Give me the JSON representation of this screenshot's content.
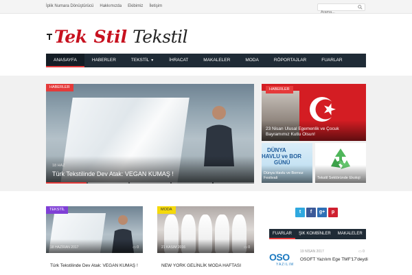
{
  "topbar": {
    "links": [
      "İplik Numara Dönüştürücü",
      "Hakkımızda",
      "Ekibimiz",
      "İletişim"
    ],
    "search_placeholder": "Arama..."
  },
  "logo": {
    "part1": "Tek",
    "part2": "Stil",
    "part3": "Tekstil"
  },
  "nav": {
    "items": [
      "ANASAYFA",
      "HABERLER",
      "TEKSTİL",
      "İHRACAT",
      "MAKALELER",
      "MODA",
      "RÖPORTAJLAR",
      "FUARLAR"
    ],
    "active": "ANASAYFA"
  },
  "hero": {
    "category": "HABERLER",
    "date": "18 HAZ",
    "title": "Türk Tekstilinde Dev Atak: VEGAN KUMAŞ !"
  },
  "side_featured": {
    "category": "HABERLER",
    "title": "23 Nisan Ulusal Egemenlik ve Çocuk Bayramımız Kutlu Olsun!"
  },
  "side_small": [
    {
      "banner": [
        "DÜNYA",
        "HAVLU ve BOR",
        "GÜNÜ"
      ],
      "caption": "Dünya Havlu ve Bornoz Festivali"
    },
    {
      "caption": "Tekstil Sektöründe Ekoloji"
    }
  ],
  "cards": [
    {
      "category": "TEKSTİL",
      "date": "18 HAZİRAN 2017",
      "comments": "0",
      "title": "Türk Tekstilinde Dev Atak: VEGAN KUMAŞ !"
    },
    {
      "category": "MODA",
      "date": "21 KASIM 2016",
      "comments": "0",
      "title": "NEW YORK GELİNLİK MODA HAFTASI"
    }
  ],
  "social": {
    "twitter": "t",
    "facebook": "f",
    "googleplus": "g+",
    "pinterest": "p"
  },
  "widget": {
    "tabs": [
      "FUARLAR",
      "ŞIK KOMBİNLER",
      "MAKALELER"
    ],
    "active_tab": "FUARLAR",
    "item": {
      "logo_text": "OSO",
      "logo_sub": "YAZILIM",
      "date": "19 NİSAN 2017",
      "comments": "0",
      "title": "OSOFT Yazılım Ege TMF'17'deydi"
    }
  },
  "colors": {
    "accent": "#e53a3a",
    "nav_bg": "#1f2b36",
    "brand": "#c7111f"
  },
  "icons": {
    "search": "search-icon",
    "comment": "comment-icon",
    "caret": "chevron-down-icon"
  }
}
